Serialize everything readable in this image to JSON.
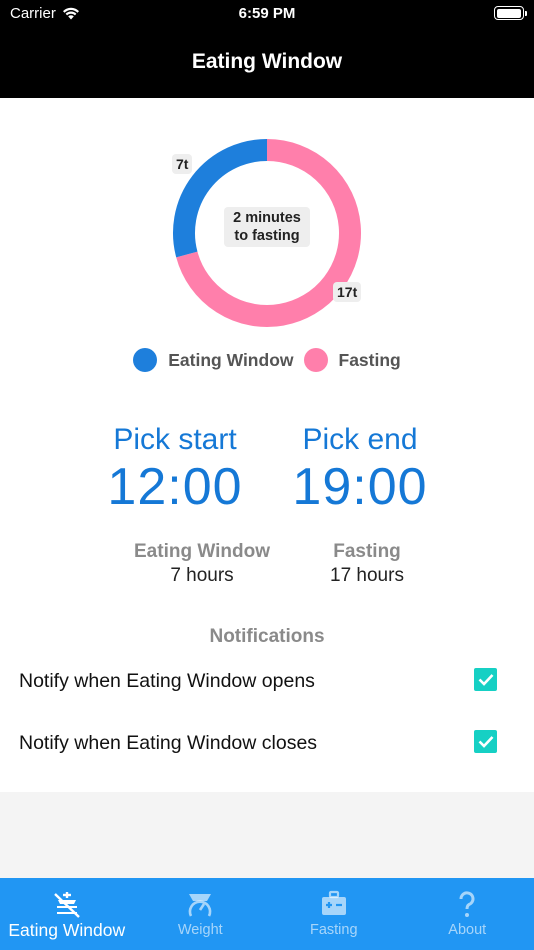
{
  "status_bar": {
    "carrier": "Carrier",
    "time": "6:59 PM"
  },
  "header": {
    "title": "Eating Window"
  },
  "donut": {
    "center_line1": "2 minutes",
    "center_line2": "to fasting",
    "eating_label": "7t",
    "fasting_label": "17t",
    "eating_hours": 7,
    "fasting_hours": 17,
    "eating_color": "#1e7fdc",
    "fasting_color": "#ff7fab"
  },
  "legend": {
    "eating": "Eating Window",
    "fasting": "Fasting"
  },
  "picker": {
    "start_label": "Pick start",
    "start_time": "12:00",
    "end_label": "Pick end",
    "end_time": "19:00"
  },
  "summary": {
    "eating_title": "Eating Window",
    "eating_value": "7 hours",
    "fasting_title": "Fasting",
    "fasting_value": "17 hours"
  },
  "notifications": {
    "title": "Notifications",
    "open_label": "Notify when Eating Window opens",
    "open_checked": true,
    "close_label": "Notify when Eating Window closes",
    "close_checked": true
  },
  "tabs": [
    {
      "label": "Eating Window",
      "icon": "no-food-icon",
      "active": true
    },
    {
      "label": "Weight",
      "icon": "scale-icon",
      "active": false
    },
    {
      "label": "Fasting",
      "icon": "medical-kit-icon",
      "active": false
    },
    {
      "label": "About",
      "icon": "question-icon",
      "active": false
    }
  ],
  "colors": {
    "accent": "#1578d6",
    "tabbar": "#2196f3",
    "checkbox": "#16d0c4"
  }
}
